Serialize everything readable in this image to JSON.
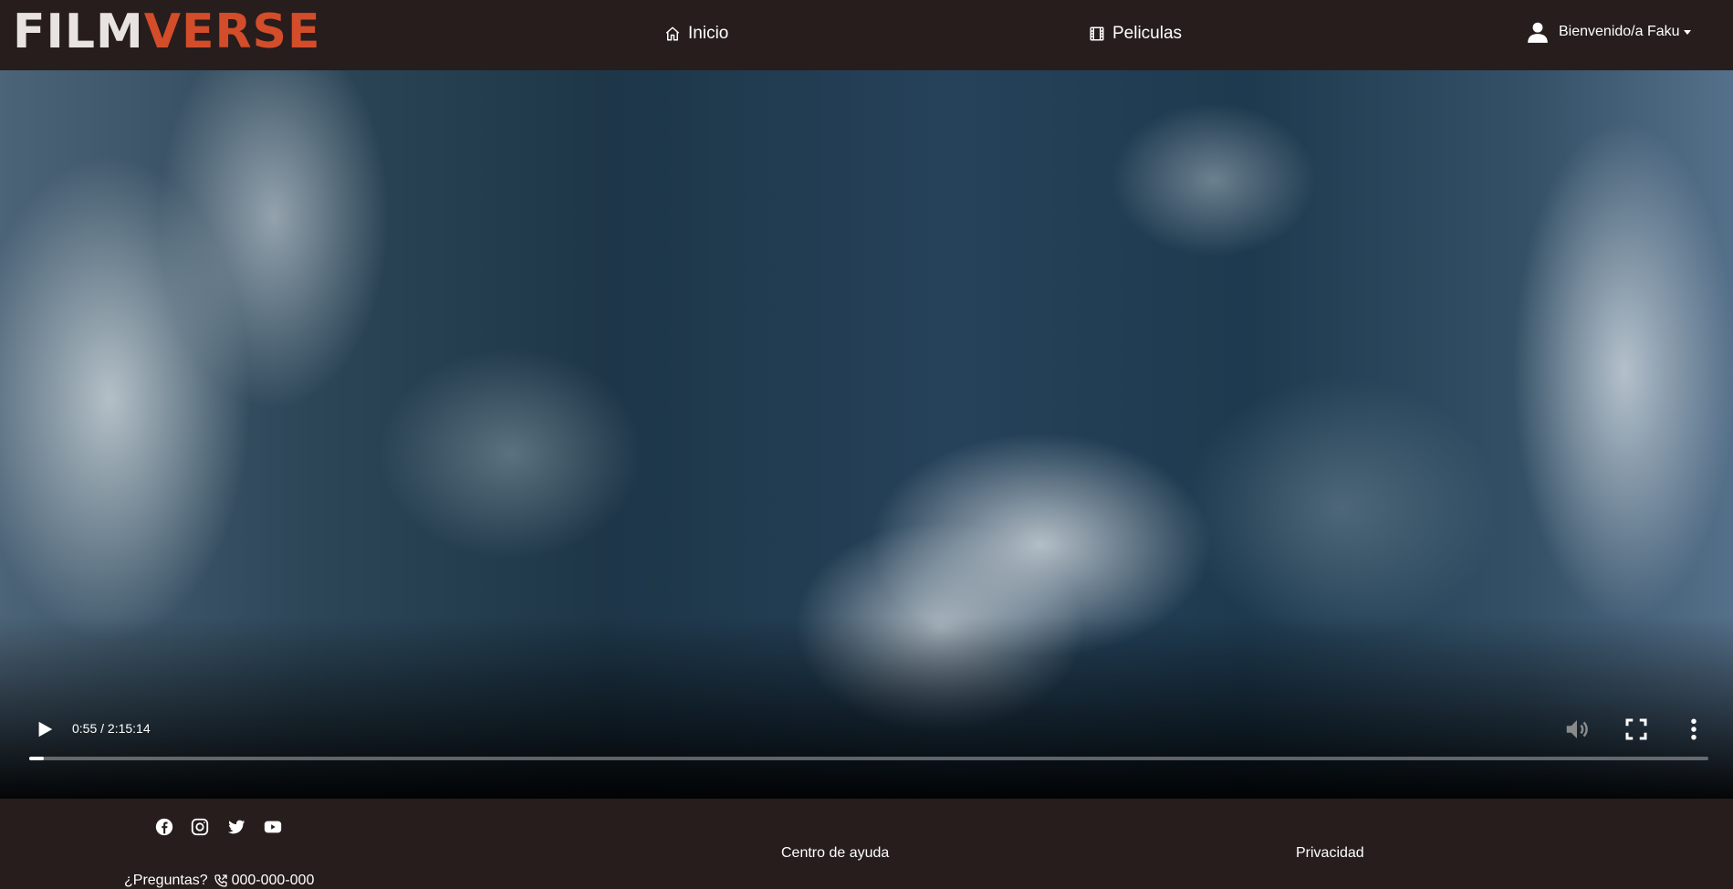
{
  "brand": {
    "part1": "FILM",
    "part2": "VERSE",
    "accent_color": "#d34d2a"
  },
  "nav": {
    "inicio": "Inicio",
    "peliculas": "Peliculas",
    "user_greeting": "Bienvenido/a Faku"
  },
  "player": {
    "current_time": "0:55",
    "duration": "2:15:14",
    "progress_fraction": 0.0068
  },
  "footer": {
    "help_question": "¿Preguntas?",
    "phone": "000-000-000",
    "help_center": "Centro de ayuda",
    "privacy": "Privacidad",
    "social_icons": [
      "facebook-icon",
      "instagram-icon",
      "twitter-icon",
      "youtube-icon"
    ]
  },
  "colors": {
    "background": "#271d1d",
    "text": "#ffffff"
  }
}
